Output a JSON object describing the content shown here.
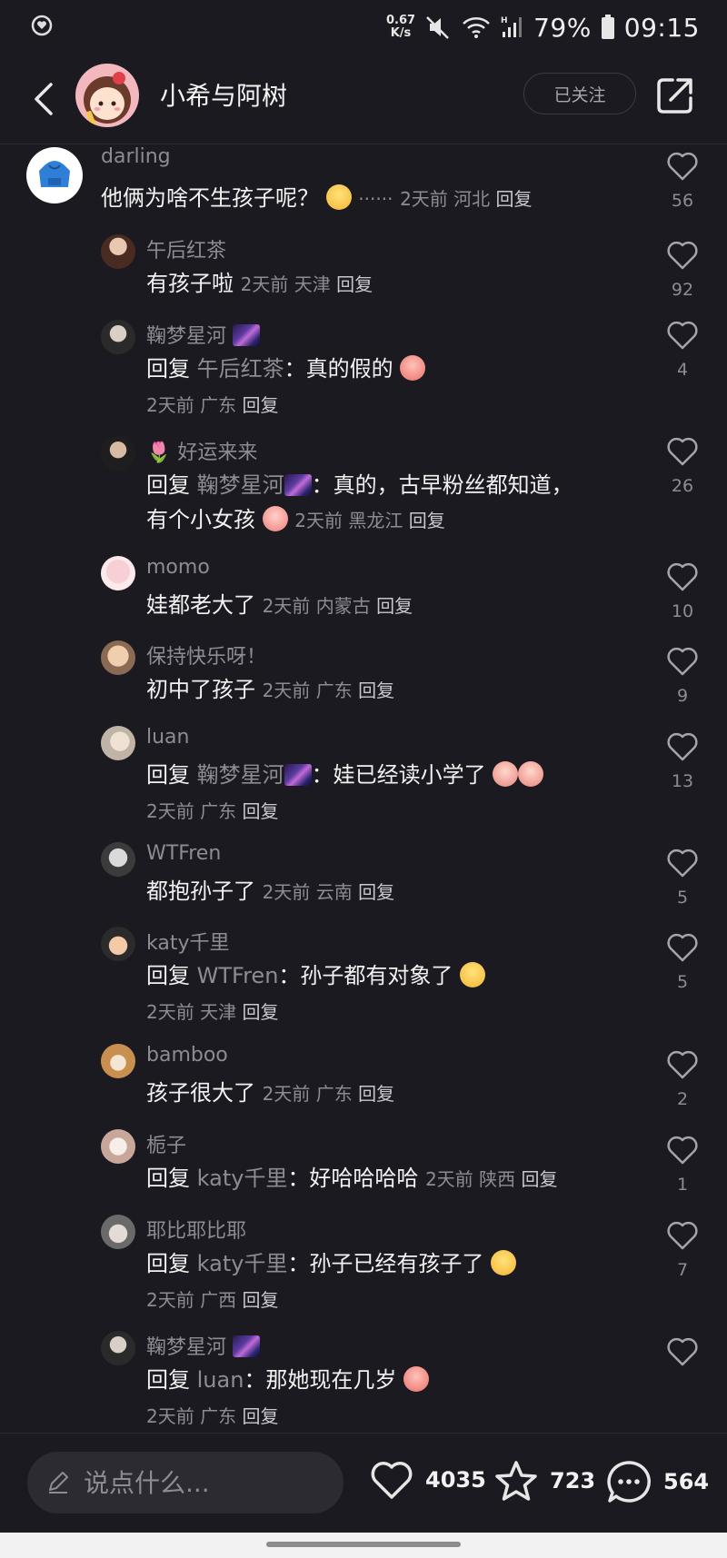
{
  "status_bar": {
    "net_speed_value": "0.67",
    "net_speed_unit": "K/s",
    "battery": "79%",
    "time": "09:15"
  },
  "header": {
    "title": "小希与阿树",
    "follow_label": "已关注"
  },
  "comments": [
    {
      "user": "darling",
      "text": "他俩为啥不生孩子呢？",
      "suffix": "······",
      "time": "2天前",
      "location": "河北",
      "reply_label": "回复",
      "likes": "56"
    },
    {
      "user": "午后红茶",
      "text": "有孩子啦",
      "time": "2天前",
      "location": "天津",
      "reply_label": "回复",
      "likes": "92"
    },
    {
      "user": "鞠梦星河",
      "reply_word": "回复",
      "reply_target": "午后红茶",
      "text": "：真的假的",
      "time": "2天前",
      "location": "广东",
      "reply_label": "回复",
      "likes": "4"
    },
    {
      "user": "好运来来",
      "reply_word": "回复",
      "reply_target": "鞠梦星河",
      "text": "：真的，古早粉丝都知道，",
      "text_line2": "有个小女孩",
      "time": "2天前",
      "location": "黑龙江",
      "reply_label": "回复",
      "likes": "26"
    },
    {
      "user": "momo",
      "text": "娃都老大了",
      "time": "2天前",
      "location": "内蒙古",
      "reply_label": "回复",
      "likes": "10"
    },
    {
      "user": "保持快乐呀！",
      "text": "初中了孩子",
      "time": "2天前",
      "location": "广东",
      "reply_label": "回复",
      "likes": "9"
    },
    {
      "user": "luan",
      "reply_word": "回复",
      "reply_target": "鞠梦星河",
      "text": "：娃已经读小学了",
      "time": "2天前",
      "location": "广东",
      "reply_label": "回复",
      "likes": "13"
    },
    {
      "user": "WTFren",
      "text": "都抱孙子了",
      "time": "2天前",
      "location": "云南",
      "reply_label": "回复",
      "likes": "5"
    },
    {
      "user": "katy千里",
      "reply_word": "回复",
      "reply_target": "WTFren",
      "text": "：孙子都有对象了",
      "time": "2天前",
      "location": "天津",
      "reply_label": "回复",
      "likes": "5"
    },
    {
      "user": "bamboo",
      "text": "孩子很大了",
      "time": "2天前",
      "location": "广东",
      "reply_label": "回复",
      "likes": "2"
    },
    {
      "user": "栀子",
      "reply_word": "回复",
      "reply_target": "katy千里",
      "text": "：好哈哈哈哈",
      "time": "2天前",
      "location": "陕西",
      "reply_label": "回复",
      "likes": "1"
    },
    {
      "user": "耶比耶比耶",
      "reply_word": "回复",
      "reply_target": "katy千里",
      "text": "：孙子已经有孩子了",
      "time": "2天前",
      "location": "广西",
      "reply_label": "回复",
      "likes": "7"
    },
    {
      "user": "鞠梦星河",
      "reply_word": "回复",
      "reply_target": "luan",
      "text": "：那她现在几岁",
      "time": "2天前",
      "location": "广东",
      "reply_label": "回复",
      "likes": ""
    }
  ],
  "bottom_bar": {
    "input_placeholder": "说点什么...",
    "likes": "4035",
    "favorites": "723",
    "comments": "564"
  },
  "colors": {
    "background": "#1b1a20",
    "muted_text": "#8d8c93",
    "primary_text": "#f2f2f2"
  }
}
